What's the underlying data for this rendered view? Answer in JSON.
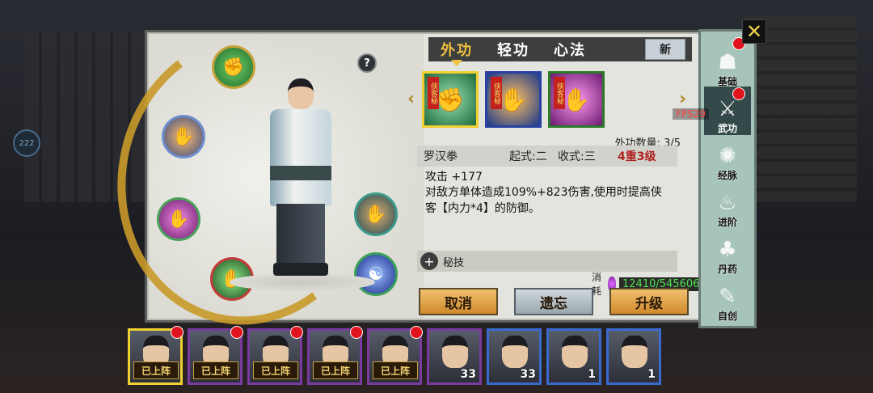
{
  "overlay": {
    "fps_left": "222",
    "fps_right": "FPS29"
  },
  "tabs": [
    {
      "label": "外功",
      "active": true
    },
    {
      "label": "轻功",
      "active": false
    },
    {
      "label": "心法",
      "active": false
    }
  ],
  "new_label": "新",
  "skill_icons": [
    {
      "tag": "侠客秘",
      "icon": "fist-icon",
      "selected": true
    },
    {
      "tag": "侠客秘",
      "icon": "palm-strike-icon",
      "selected": false
    },
    {
      "tag": "侠客秘",
      "icon": "palm-energy-icon",
      "selected": false
    }
  ],
  "skill": {
    "count_label": "外功数量:",
    "count_value": "3/5",
    "name": "罗汉拳",
    "start_form": "起式:二",
    "end_form": "收式:三",
    "level": "4重3级",
    "stat": "攻击 +177",
    "description": "对敌方单体造成109%+823伤害,使用时提高侠客【内力*4】的防御。"
  },
  "secret_label": "秘技",
  "cost": {
    "label": "消耗",
    "value": "12410/545606"
  },
  "buttons": {
    "cancel": "取消",
    "forget": "遗忘",
    "upgrade": "升级"
  },
  "sidebar": [
    {
      "label": "基础",
      "icon": "figure-icon",
      "active": false,
      "dot": true
    },
    {
      "label": "武功",
      "icon": "martial-pose-icon",
      "active": true,
      "dot": true
    },
    {
      "label": "经脉",
      "icon": "meridian-icon",
      "active": false,
      "dot": false
    },
    {
      "label": "进阶",
      "icon": "flame-icon",
      "active": false,
      "dot": false
    },
    {
      "label": "丹药",
      "icon": "gourd-icon",
      "active": false,
      "dot": false
    },
    {
      "label": "自创",
      "icon": "scroll-icon",
      "active": false,
      "dot": false
    }
  ],
  "roster": [
    {
      "badge": "已上阵",
      "num": "",
      "frame": "gold",
      "dot": true
    },
    {
      "badge": "已上阵",
      "num": "",
      "frame": "purple",
      "dot": true
    },
    {
      "badge": "已上阵",
      "num": "",
      "frame": "purple",
      "dot": true
    },
    {
      "badge": "已上阵",
      "num": "",
      "frame": "purple",
      "dot": true
    },
    {
      "badge": "已上阵",
      "num": "",
      "frame": "purple",
      "dot": true
    },
    {
      "badge": "",
      "num": "33",
      "frame": "purple",
      "dot": false
    },
    {
      "badge": "",
      "num": "33",
      "frame": "blue",
      "dot": false
    },
    {
      "badge": "",
      "num": "1",
      "frame": "blue",
      "dot": false
    },
    {
      "badge": "",
      "num": "1",
      "frame": "blue",
      "dot": false
    }
  ]
}
